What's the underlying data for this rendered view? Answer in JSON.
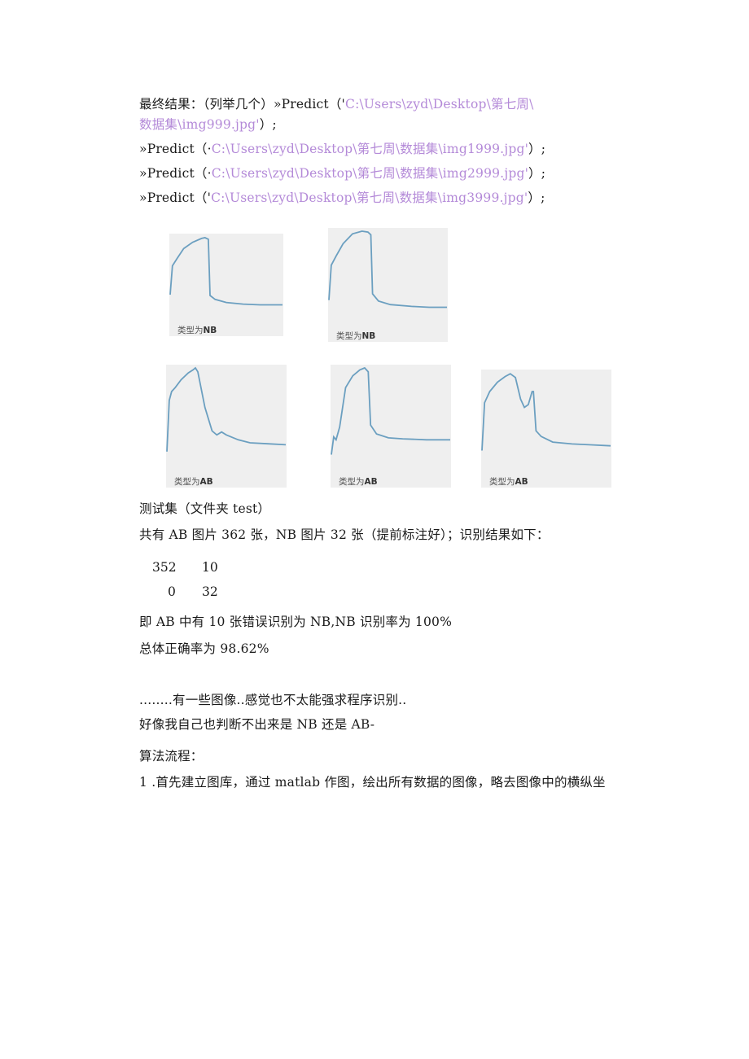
{
  "results": {
    "heading": "最终结果：（列举几个）",
    "prompt": "»",
    "calls": [
      {
        "func": "Predict",
        "open": "（'",
        "path_a": "C:\\Users\\zyd\\Desktop\\第七周\\",
        "path_b": "数据集\\img999.jpg'",
        "close": "）;"
      },
      {
        "func": "Predict",
        "open": "（·",
        "path": "C:\\Users\\zyd\\Desktop\\第七周\\数据集\\img1999.jpg'",
        "close": "）;"
      },
      {
        "func": "Predict",
        "open": "（·",
        "path": "C:\\Users\\zyd\\Desktop\\第七周\\数据集\\img2999.jpg'",
        "close": "）;"
      },
      {
        "func": "Predict",
        "open": "（'",
        "path": "C:\\Users\\zyd\\Desktop\\第七周\\数据集\\img3999.jpg'",
        "close": "）;"
      }
    ]
  },
  "figures": [
    {
      "caption_prefix": "类型为",
      "caption_type": "NB",
      "shape": "nb1"
    },
    {
      "caption_prefix": "类型为",
      "caption_type": "NB",
      "shape": "nb2"
    },
    {
      "caption_prefix": "类型为",
      "caption_type": "AB",
      "shape": "ab1"
    },
    {
      "caption_prefix": "类型为",
      "caption_type": "AB",
      "shape": "ab2"
    },
    {
      "caption_prefix": "类型为",
      "caption_type": "AB",
      "shape": "ab3"
    }
  ],
  "colors": {
    "curve": "#6b9fc0",
    "path_text": "#b48ad8",
    "figure_bg": "#efefef"
  },
  "test": {
    "heading": "测试集（文件夹 test）",
    "summary": "共有 AB 图片 362 张，NB 图片 32 张（提前标注好）；识别结果如下：",
    "matrix": [
      [
        "352",
        "10"
      ],
      [
        "0",
        "32"
      ]
    ],
    "error_note": "即 AB 中有 10 张错误识别为 NB,NB 识别率为 100%",
    "accuracy": "总体正确率为 98.62%"
  },
  "notes": {
    "line1": "........有一些图像..感觉也不太能强求程序识别..",
    "line2": "好像我自己也判断不出来是 NB 还是 AB-"
  },
  "algorithm": {
    "heading": "算法流程：",
    "step1": "1 .首先建立图库，通过 matlab 作图，绘出所有数据的图像，略去图像中的横纵坐"
  }
}
